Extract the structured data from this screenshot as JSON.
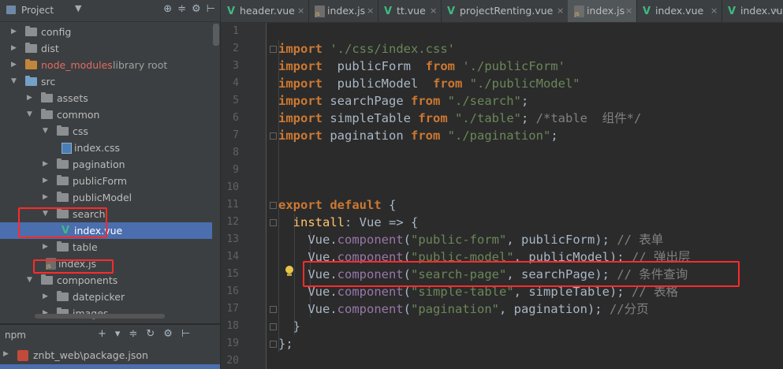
{
  "project_panel": {
    "title": "Project",
    "dropdown_icon": "chevron-down-icon",
    "toolbar_icons": [
      "target-icon",
      "collapse-icon",
      "gear-icon",
      "hide-icon"
    ],
    "tree": [
      {
        "label": "config",
        "type": "folder",
        "depth": 0,
        "expanded": false
      },
      {
        "label": "dist",
        "type": "folder",
        "depth": 0,
        "expanded": false
      },
      {
        "label": "node_modules",
        "suffix": "library root",
        "type": "folder-excluded",
        "depth": 0,
        "expanded": false
      },
      {
        "label": "src",
        "type": "folder-source",
        "depth": 0,
        "expanded": true
      },
      {
        "label": "assets",
        "type": "folder",
        "depth": 1,
        "expanded": false
      },
      {
        "label": "common",
        "type": "folder",
        "depth": 1,
        "expanded": true
      },
      {
        "label": "css",
        "type": "folder",
        "depth": 2,
        "expanded": true
      },
      {
        "label": "index.css",
        "type": "file-css",
        "depth": 3
      },
      {
        "label": "pagination",
        "type": "folder",
        "depth": 2,
        "expanded": false
      },
      {
        "label": "publicForm",
        "type": "folder",
        "depth": 2,
        "expanded": false
      },
      {
        "label": "publicModel",
        "type": "folder",
        "depth": 2,
        "expanded": false
      },
      {
        "label": "search",
        "type": "folder",
        "depth": 2,
        "expanded": true
      },
      {
        "label": "index.vue",
        "type": "file-vue",
        "depth": 3,
        "selected": true
      },
      {
        "label": "table",
        "type": "folder",
        "depth": 2,
        "expanded": false
      },
      {
        "label": "index.js",
        "type": "file-js",
        "depth": 2
      },
      {
        "label": "components",
        "type": "folder",
        "depth": 1,
        "expanded": true
      },
      {
        "label": "datepicker",
        "type": "folder",
        "depth": 2,
        "expanded": false
      },
      {
        "label": "images",
        "type": "folder",
        "depth": 2,
        "expanded": false
      }
    ]
  },
  "npm_panel": {
    "title": "npm",
    "toolbar_icons": [
      "plus-icon",
      "chevron-down-icon",
      "collapse-icon",
      "refresh-icon",
      "gear-icon",
      "hide-icon"
    ],
    "item": "znbt_web\\package.json"
  },
  "tabs": [
    {
      "label": "header.vue",
      "type": "vue",
      "active": false
    },
    {
      "label": "index.js",
      "type": "js",
      "active": false
    },
    {
      "label": "tt.vue",
      "type": "vue",
      "active": false
    },
    {
      "label": "projectRenting.vue",
      "type": "vue",
      "active": false
    },
    {
      "label": "index.js",
      "type": "js",
      "active": true
    },
    {
      "label": "index.vue",
      "type": "vue",
      "active": false
    },
    {
      "label": "index.vue",
      "type": "vue",
      "active": false
    }
  ],
  "editor": {
    "line_numbers": [
      "1",
      "2",
      "3",
      "4",
      "5",
      "6",
      "7",
      "8",
      "9",
      "10",
      "11",
      "12",
      "13",
      "14",
      "15",
      "16",
      "17",
      "18",
      "19",
      "20"
    ],
    "lines": [
      [],
      [
        {
          "t": "import",
          "c": "kw"
        },
        {
          "t": " "
        },
        {
          "t": "'./css/index.css'",
          "c": "str"
        }
      ],
      [
        {
          "t": "import",
          "c": "kw"
        },
        {
          "t": "  publicForm  "
        },
        {
          "t": "from",
          "c": "kw"
        },
        {
          "t": " "
        },
        {
          "t": "'./publicForm'",
          "c": "str"
        }
      ],
      [
        {
          "t": "import",
          "c": "kw"
        },
        {
          "t": "  publicModel  "
        },
        {
          "t": "from",
          "c": "kw"
        },
        {
          "t": " "
        },
        {
          "t": "\"./publicModel\"",
          "c": "str"
        }
      ],
      [
        {
          "t": "import",
          "c": "kw"
        },
        {
          "t": " searchPage "
        },
        {
          "t": "from",
          "c": "kw"
        },
        {
          "t": " "
        },
        {
          "t": "\"./search\"",
          "c": "str"
        },
        {
          "t": ";"
        }
      ],
      [
        {
          "t": "import",
          "c": "kw"
        },
        {
          "t": " simpleTable "
        },
        {
          "t": "from",
          "c": "kw"
        },
        {
          "t": " "
        },
        {
          "t": "\"./table\"",
          "c": "str"
        },
        {
          "t": "; "
        },
        {
          "t": "/*table  组件*/",
          "c": "cmt"
        }
      ],
      [
        {
          "t": "import",
          "c": "kw"
        },
        {
          "t": " pagination "
        },
        {
          "t": "from",
          "c": "kw"
        },
        {
          "t": " "
        },
        {
          "t": "\"./pagination\"",
          "c": "str"
        },
        {
          "t": ";"
        }
      ],
      [],
      [],
      [],
      [
        {
          "t": "export",
          "c": "kw"
        },
        {
          "t": " "
        },
        {
          "t": "default",
          "c": "kw"
        },
        {
          "t": " {"
        }
      ],
      [
        {
          "t": "  "
        },
        {
          "t": "install",
          "c": "fn"
        },
        {
          "t": ": Vue => {"
        }
      ],
      [
        {
          "t": "    Vue."
        },
        {
          "t": "component",
          "c": "prop"
        },
        {
          "t": "("
        },
        {
          "t": "\"public-form\"",
          "c": "str"
        },
        {
          "t": ", publicForm); "
        },
        {
          "t": "// 表单",
          "c": "cmt"
        }
      ],
      [
        {
          "t": "    Vue."
        },
        {
          "t": "component",
          "c": "prop"
        },
        {
          "t": "("
        },
        {
          "t": "\"public-model\"",
          "c": "str"
        },
        {
          "t": ", publicModel); "
        },
        {
          "t": "// 弹出层",
          "c": "cmt"
        }
      ],
      [
        {
          "t": "    Vue."
        },
        {
          "t": "component",
          "c": "prop"
        },
        {
          "t": "("
        },
        {
          "t": "\"search-page\"",
          "c": "str"
        },
        {
          "t": ", searchPage); "
        },
        {
          "t": "// 条件查询",
          "c": "cmt"
        }
      ],
      [
        {
          "t": "    Vue."
        },
        {
          "t": "component",
          "c": "prop"
        },
        {
          "t": "("
        },
        {
          "t": "\"simple-table\"",
          "c": "str"
        },
        {
          "t": ", simpleTable); "
        },
        {
          "t": "// 表格",
          "c": "cmt"
        }
      ],
      [
        {
          "t": "    Vue."
        },
        {
          "t": "component",
          "c": "prop"
        },
        {
          "t": "("
        },
        {
          "t": "\"pagination\"",
          "c": "str"
        },
        {
          "t": ", pagination); "
        },
        {
          "t": "//分页",
          "c": "cmt"
        }
      ],
      [
        {
          "t": "  }"
        }
      ],
      [
        {
          "t": "};"
        }
      ],
      []
    ]
  },
  "colors": {
    "keyword": "#cc7832",
    "string": "#6a8759",
    "comment": "#808080",
    "selection": "#4b6eaf",
    "highlight_box": "#ff2a2a"
  }
}
